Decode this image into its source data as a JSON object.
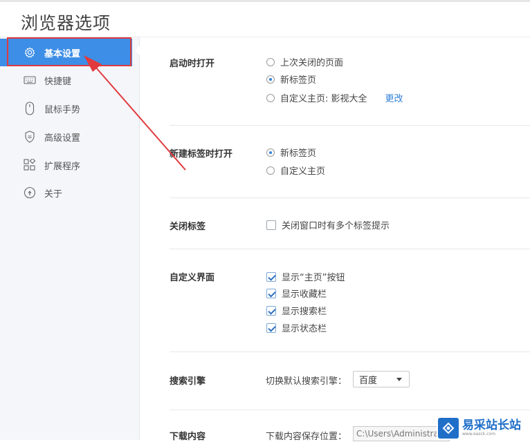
{
  "window": {
    "title": "浏览器选项"
  },
  "sidebar": {
    "items": [
      {
        "label": "基本设置",
        "icon": "gear-icon"
      },
      {
        "label": "快捷键",
        "icon": "keyboard-icon"
      },
      {
        "label": "鼠标手势",
        "icon": "mouse-icon"
      },
      {
        "label": "高级设置",
        "icon": "shield-icon"
      },
      {
        "label": "扩展程序",
        "icon": "extensions-icon"
      },
      {
        "label": "关于",
        "icon": "info-icon"
      }
    ],
    "active_index": 0
  },
  "sections": {
    "startup": {
      "label": "启动时打开",
      "options": [
        {
          "label": "上次关闭的页面",
          "checked": false
        },
        {
          "label": "新标签页",
          "checked": true
        },
        {
          "label": "自定义主页: 影视大全",
          "checked": false
        }
      ],
      "change_link": "更改"
    },
    "new_tab": {
      "label": "新建标签时打开",
      "options": [
        {
          "label": "新标签页",
          "checked": true
        },
        {
          "label": "自定义主页",
          "checked": false
        }
      ]
    },
    "close_tab": {
      "label": "关闭标签",
      "option": {
        "label": "关闭窗口时有多个标签提示",
        "checked": false
      }
    },
    "custom_ui": {
      "label": "自定义界面",
      "options": [
        {
          "label": "显示“主页”按钮",
          "checked": true
        },
        {
          "label": "显示收藏栏",
          "checked": true
        },
        {
          "label": "显示搜索栏",
          "checked": true
        },
        {
          "label": "显示状态栏",
          "checked": true
        }
      ]
    },
    "search": {
      "label": "搜索引擎",
      "prompt": "切换默认搜索引擎：",
      "selected": "百度"
    },
    "download": {
      "label": "下载内容",
      "prompt": "下载内容保存位置：",
      "path": "C:\\Users\\Administrator"
    }
  },
  "watermark": {
    "main": "易采站长站",
    "sub": "www.easck.com"
  },
  "colors": {
    "accent": "#3d8ee6",
    "highlight": "#e03a3e",
    "link": "#2f7fd8"
  }
}
